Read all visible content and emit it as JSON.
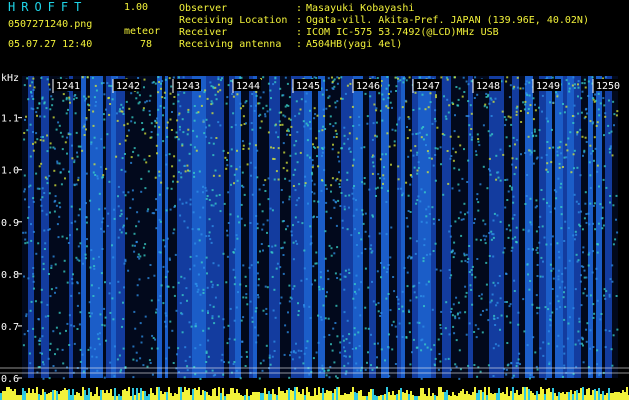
{
  "header": {
    "app_title": "HROFFT",
    "version": "1.00",
    "filename": "0507271240.png",
    "mode": "meteor",
    "datetime": "05.07.27 12:40",
    "count": "78"
  },
  "info": [
    {
      "label": "Observer",
      "value": "Masayuki Kobayashi"
    },
    {
      "label": "Receiving Location",
      "value": "Ogata-vill. Akita-Pref. JAPAN (139.96E, 40.02N)"
    },
    {
      "label": "Receiver",
      "value": "ICOM IC-575 53.7492(@LCD)MHz USB"
    },
    {
      "label": "Receiving antenna",
      "value": "A504HB(yagi 4el)"
    }
  ],
  "info_separator": ":",
  "spectrogram": {
    "freq_unit": "kHz",
    "freq_ticks": [
      "1.1",
      "1.0",
      "0.9",
      "0.8",
      "0.7",
      "0.6"
    ],
    "freq_range": [
      0.6,
      1.18
    ],
    "time_labels": [
      "1241",
      "1242",
      "1243",
      "1244",
      "1245",
      "1246",
      "1247",
      "1248",
      "1249",
      "1250"
    ],
    "colors": {
      "background": "#000000",
      "low": "#0a1a6a",
      "mid": "#1e6ad8",
      "high": "#3ad2c8",
      "peak": "#d8e83a",
      "grid": "#f0f0f0",
      "label_bg": "#000000",
      "label_fg": "#ffffff",
      "power_bar": "#f2f23a"
    }
  }
}
